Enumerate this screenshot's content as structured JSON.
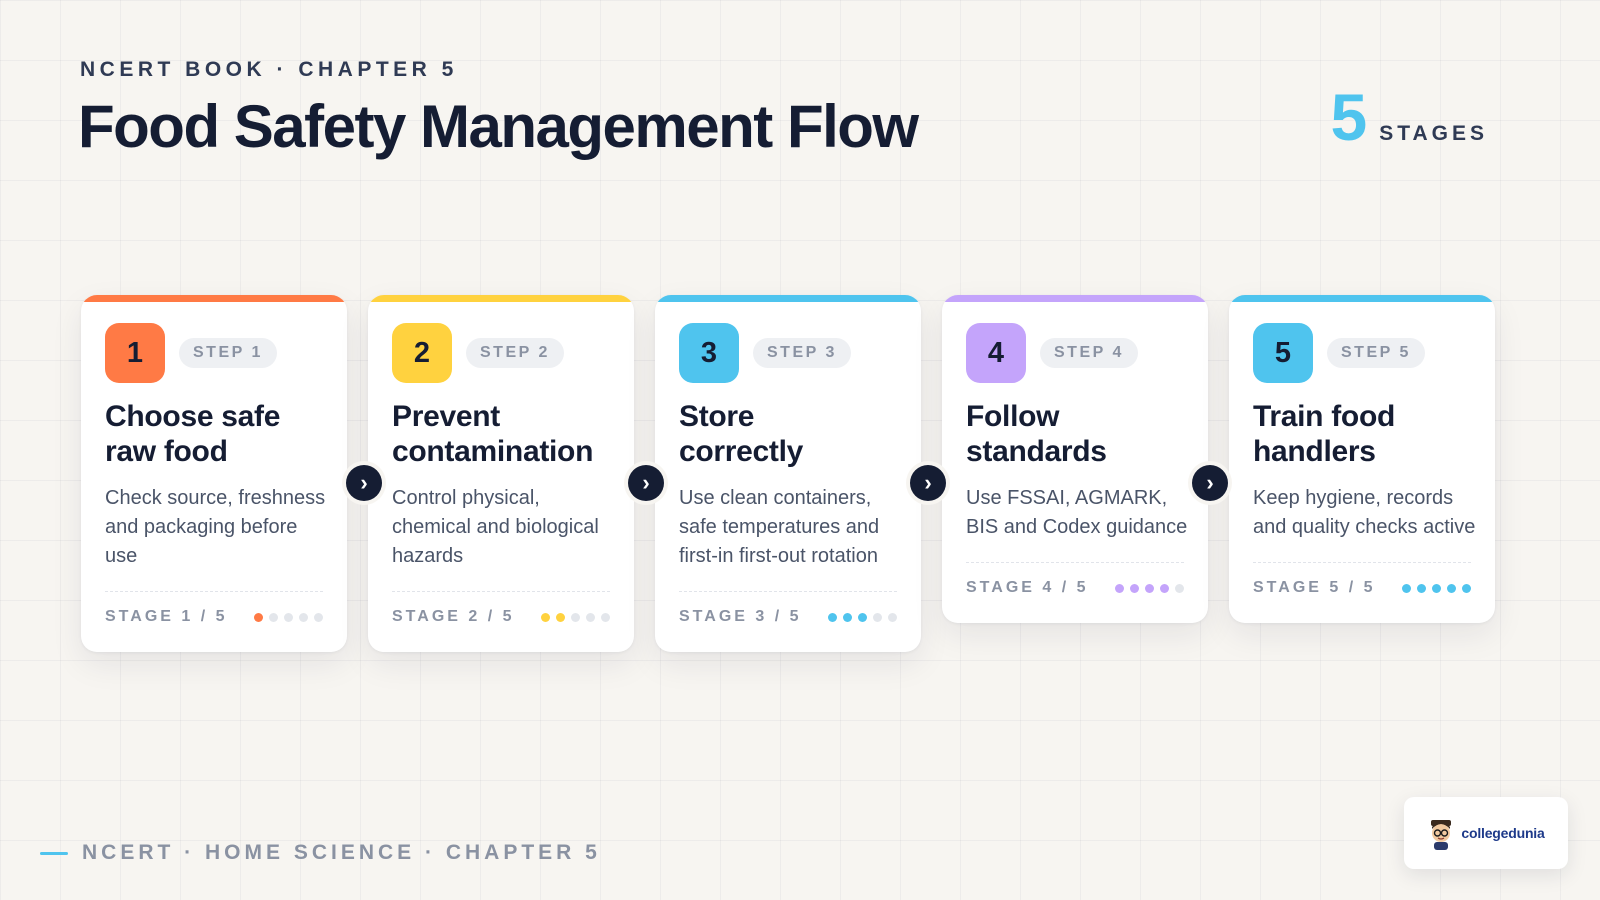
{
  "header": {
    "kicker": "NCERT BOOK · CHAPTER 5",
    "title": "Food Safety Management Flow",
    "stages_count": "5",
    "stages_label": "STAGES",
    "accent_color": "#4fc4ee"
  },
  "steps": [
    {
      "number": "1",
      "step_label": "STEP 1",
      "title_line1": "Choose safe",
      "title_line2": "raw food",
      "description": "Check source, freshness and packaging before use",
      "stage_label": "STAGE 1 / 5",
      "progress": 1,
      "color": "#ff7a45"
    },
    {
      "number": "2",
      "step_label": "STEP 2",
      "title_line1": "Prevent",
      "title_line2": "contamination",
      "description": "Control physical, chemical and biological hazards",
      "stage_label": "STAGE 2 / 5",
      "progress": 2,
      "color": "#ffd23f"
    },
    {
      "number": "3",
      "step_label": "STEP 3",
      "title_line1": "Store",
      "title_line2": "correctly",
      "description": "Use clean containers, safe temperatures and first-in first-out rotation",
      "stage_label": "STAGE 3 / 5",
      "progress": 3,
      "color": "#4fc4ee"
    },
    {
      "number": "4",
      "step_label": "STEP 4",
      "title_line1": "Follow",
      "title_line2": "standards",
      "description": "Use FSSAI, AGMARK, BIS and Codex guidance",
      "stage_label": "STAGE 4 / 5",
      "progress": 4,
      "color": "#c4a4fb"
    },
    {
      "number": "5",
      "step_label": "STEP 5",
      "title_line1": "Train food",
      "title_line2": "handlers",
      "description": "Keep hygiene, records and quality checks active",
      "stage_label": "STAGE 5 / 5",
      "progress": 5,
      "color": "#4fc4ee"
    }
  ],
  "arrow_icon": "chevron-right-icon",
  "footer": {
    "text": "NCERT · HOME SCIENCE · CHAPTER 5"
  },
  "brand": {
    "name": "collegedunia"
  }
}
